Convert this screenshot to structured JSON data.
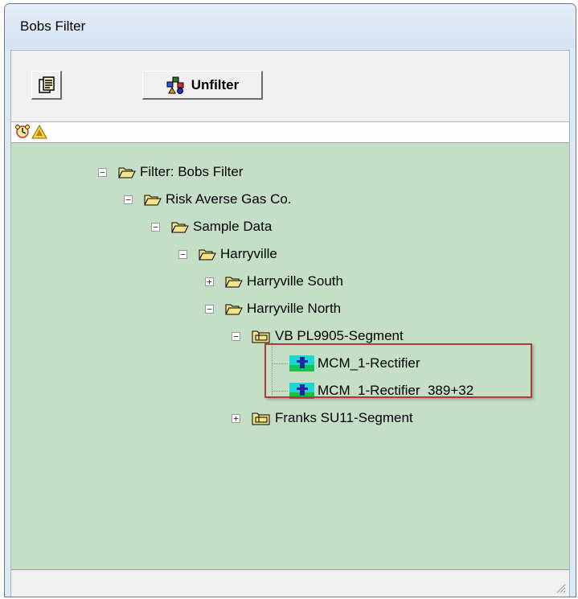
{
  "window": {
    "title": "Bobs Filter"
  },
  "toolbar": {
    "properties_icon": "document-properties-icon",
    "unfilter_label": "Unfilter",
    "unfilter_icon": "filter-objects-icon"
  },
  "strip": {
    "icons": [
      "clock-alarm-icon",
      "warning-triangle-icon"
    ]
  },
  "tree": {
    "nodes": [
      {
        "label": "Filter: Bobs Filter",
        "expander": "−",
        "icon": "open-folder-icon"
      },
      {
        "label": "Risk Averse Gas Co.",
        "expander": "−",
        "icon": "open-folder-icon"
      },
      {
        "label": "Sample Data",
        "expander": "−",
        "icon": "open-folder-icon"
      },
      {
        "label": "Harryville",
        "expander": "−",
        "icon": "open-folder-icon"
      },
      {
        "label": "Harryville South",
        "expander": "+",
        "icon": "open-folder-icon"
      },
      {
        "label": "Harryville North",
        "expander": "−",
        "icon": "open-folder-icon"
      },
      {
        "label": "VB PL9905-Segment",
        "expander": "−",
        "icon": "segment-folder-icon"
      },
      {
        "label": "MCM_1-Rectifier",
        "expander": "",
        "icon": "rectifier-icon"
      },
      {
        "label": "MCM_1-Rectifier_389+32",
        "expander": "",
        "icon": "rectifier-icon"
      },
      {
        "label": "Franks SU11-Segment",
        "expander": "+",
        "icon": "segment-folder-icon"
      }
    ]
  },
  "colors": {
    "tree_background": "#c5dfc7",
    "highlight_border": "#b03a3a",
    "folder_yellow": "#f3e38a"
  }
}
